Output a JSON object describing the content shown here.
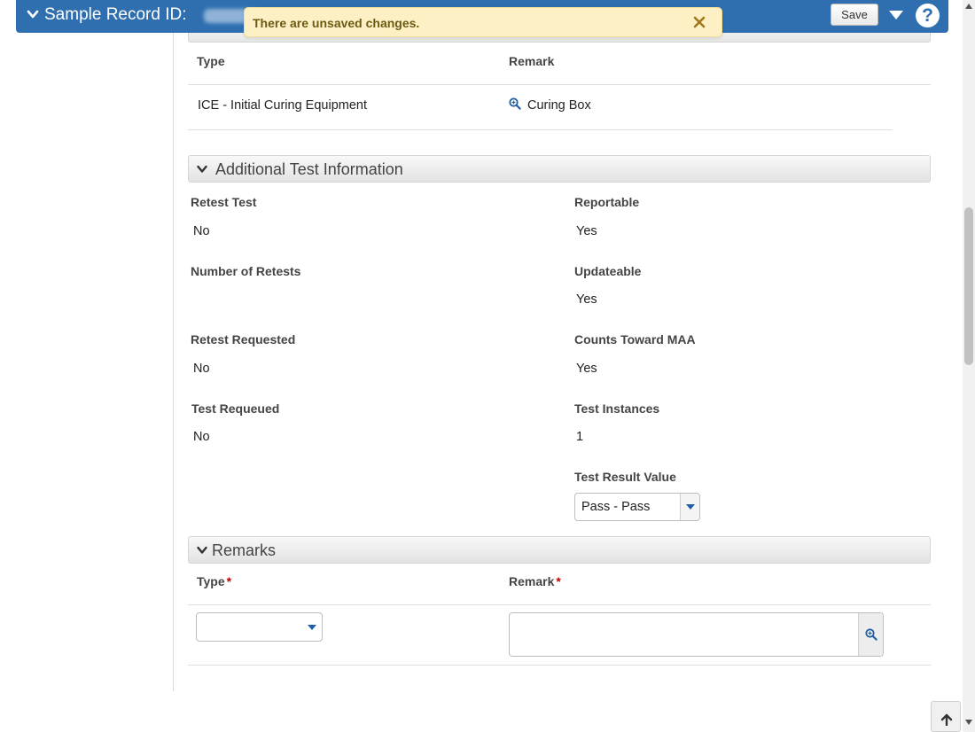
{
  "header": {
    "title": "Sample Record ID:",
    "save_label": "Save",
    "help_symbol": "?",
    "brand_color": "#2f6fb0"
  },
  "notification": {
    "message": "There are unsaved changes."
  },
  "equipment_table": {
    "columns": {
      "type": "Type",
      "remark": "Remark"
    },
    "rows": [
      {
        "type": "ICE - Initial Curing Equipment",
        "remark": "Curing Box"
      }
    ]
  },
  "additional_test_info": {
    "title": "Additional Test Information",
    "retest_test": {
      "label": "Retest Test",
      "value": "No"
    },
    "reportable": {
      "label": "Reportable",
      "value": "Yes"
    },
    "number_of_retests": {
      "label": "Number of Retests",
      "value": ""
    },
    "updateable": {
      "label": "Updateable",
      "value": "Yes"
    },
    "retest_requested": {
      "label": "Retest Requested",
      "value": "No"
    },
    "counts_toward_maa": {
      "label": "Counts Toward MAA",
      "value": "Yes"
    },
    "test_requeued": {
      "label": "Test Requeued",
      "value": "No"
    },
    "test_instances": {
      "label": "Test Instances",
      "value": "1"
    },
    "test_result_value": {
      "label": "Test Result Value",
      "selected": "Pass - Pass"
    }
  },
  "remarks": {
    "title": "Remarks",
    "columns": {
      "type": "Type",
      "remark": "Remark"
    },
    "required_marker": "*",
    "type_selected": "",
    "remark_value": ""
  },
  "icons": {
    "header_chevron": "chevron-down-icon",
    "menu_caret": "caret-down-icon",
    "help": "help-icon",
    "close": "close-icon",
    "lookup": "magnifier-icon",
    "back_to_top": "arrow-up-icon"
  }
}
